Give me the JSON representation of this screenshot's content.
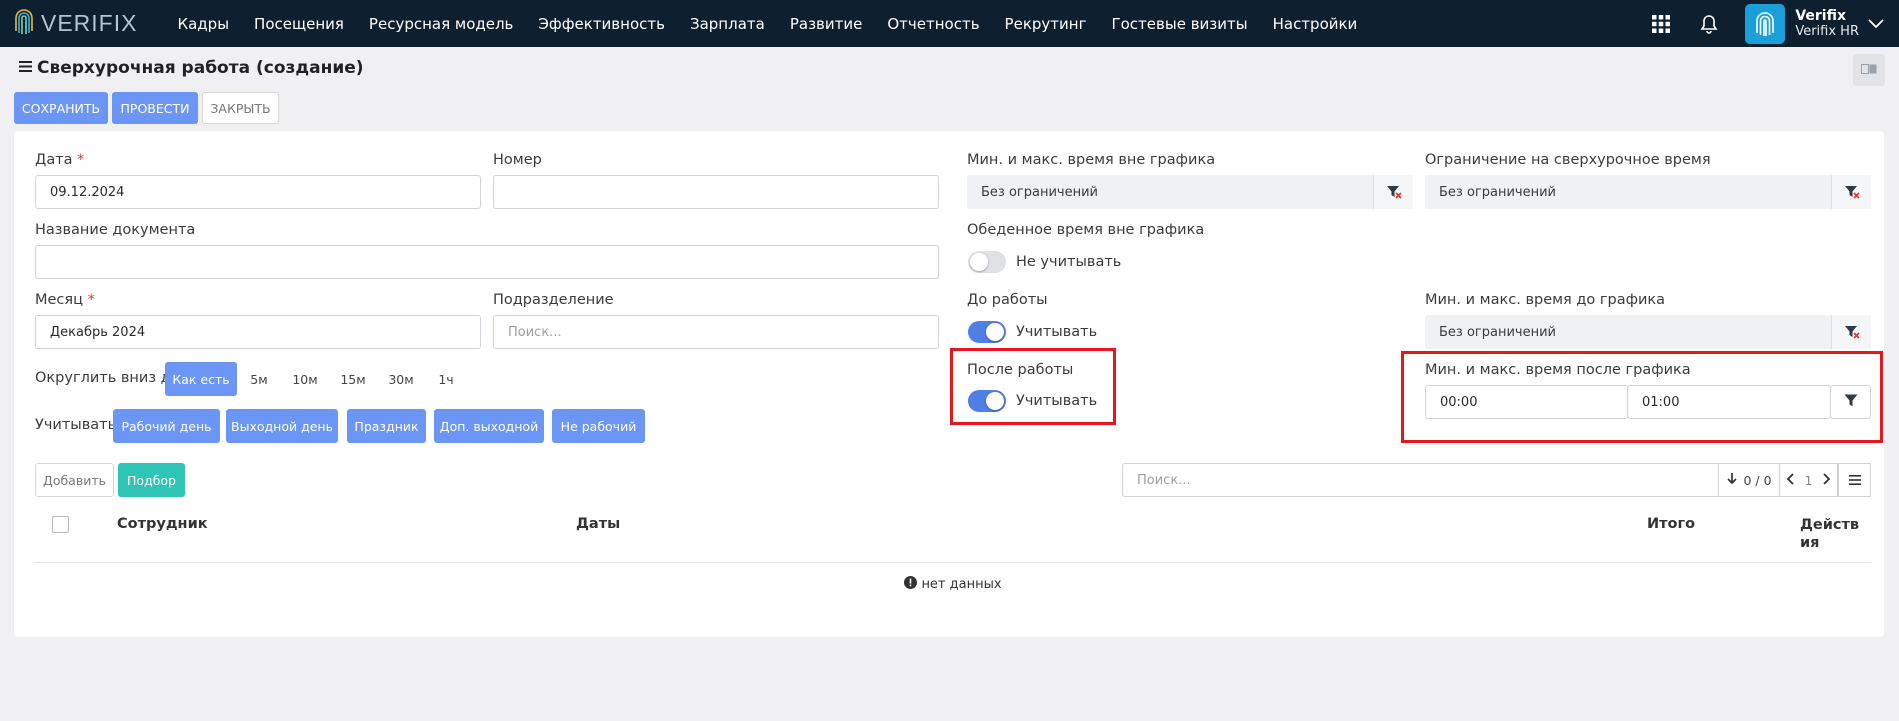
{
  "topbar": {
    "logo_text": "VERIFIX",
    "nav": [
      "Кадры",
      "Посещения",
      "Ресурсная модель",
      "Эффективность",
      "Зарплата",
      "Развитие",
      "Отчетность",
      "Рекрутинг",
      "Гостевые визиты",
      "Настройки"
    ],
    "user_name": "Verifix",
    "user_company": "Verifix HR"
  },
  "page": {
    "title": "Сверхурочная работа (создание)",
    "save_label": "СОХРАНИТЬ",
    "post_label": "ПРОВЕСТИ",
    "close_label": "ЗАКРЫТЬ"
  },
  "form": {
    "date_label": "Дата",
    "date_value": "09.12.2024",
    "required_mark": "*",
    "number_label": "Номер",
    "number_value": "",
    "doc_name_label": "Название документа",
    "doc_name_value": "",
    "month_label": "Месяц",
    "month_value": "Декабрь 2024",
    "division_label": "Подразделение",
    "division_placeholder": "Поиск...",
    "round_label": "Округлить вниз до:",
    "round_options": [
      "Как есть",
      "5м",
      "10м",
      "15м",
      "30м",
      "1ч"
    ],
    "consider_label": "Учитывать:",
    "consider_options": [
      "Рабочий день",
      "Выходной день",
      "Праздник",
      "Доп. выходной",
      "Не рабочий"
    ],
    "outside_minmax_label": "Мин. и макс. время вне графика",
    "outside_minmax_value": "Без ограничений",
    "overtime_limit_label": "Ограничение на сверхурочное время",
    "overtime_limit_value": "Без ограничений",
    "lunch_label": "Обеденное время вне графика",
    "lunch_toggle_label": "Не учитывать",
    "before_label": "До работы",
    "before_toggle_label": "Учитывать",
    "before_minmax_label": "Мин. и макс. время до графика",
    "before_minmax_value": "Без ограничений",
    "after_label": "После работы",
    "after_toggle_label": "Учитывать",
    "after_minmax_label": "Мин. и макс. время после графика",
    "after_min_value": "00:00",
    "after_max_value": "01:00"
  },
  "table": {
    "add_label": "Добавить",
    "pick_label": "Подбор",
    "search_placeholder": "Поиск...",
    "count": "0 / 0",
    "page": "1",
    "col_employee": "Сотрудник",
    "col_dates": "Даты",
    "col_total": "Итого",
    "col_actions_1": "Действ",
    "col_actions_2": "ия",
    "empty_text": "нет данных"
  },
  "colors": {
    "primary": "#6c96f5",
    "teal": "#2ec4b6",
    "topbar": "#0e1f30",
    "highlight": "#e8151b",
    "filter_red": "#e53935"
  }
}
